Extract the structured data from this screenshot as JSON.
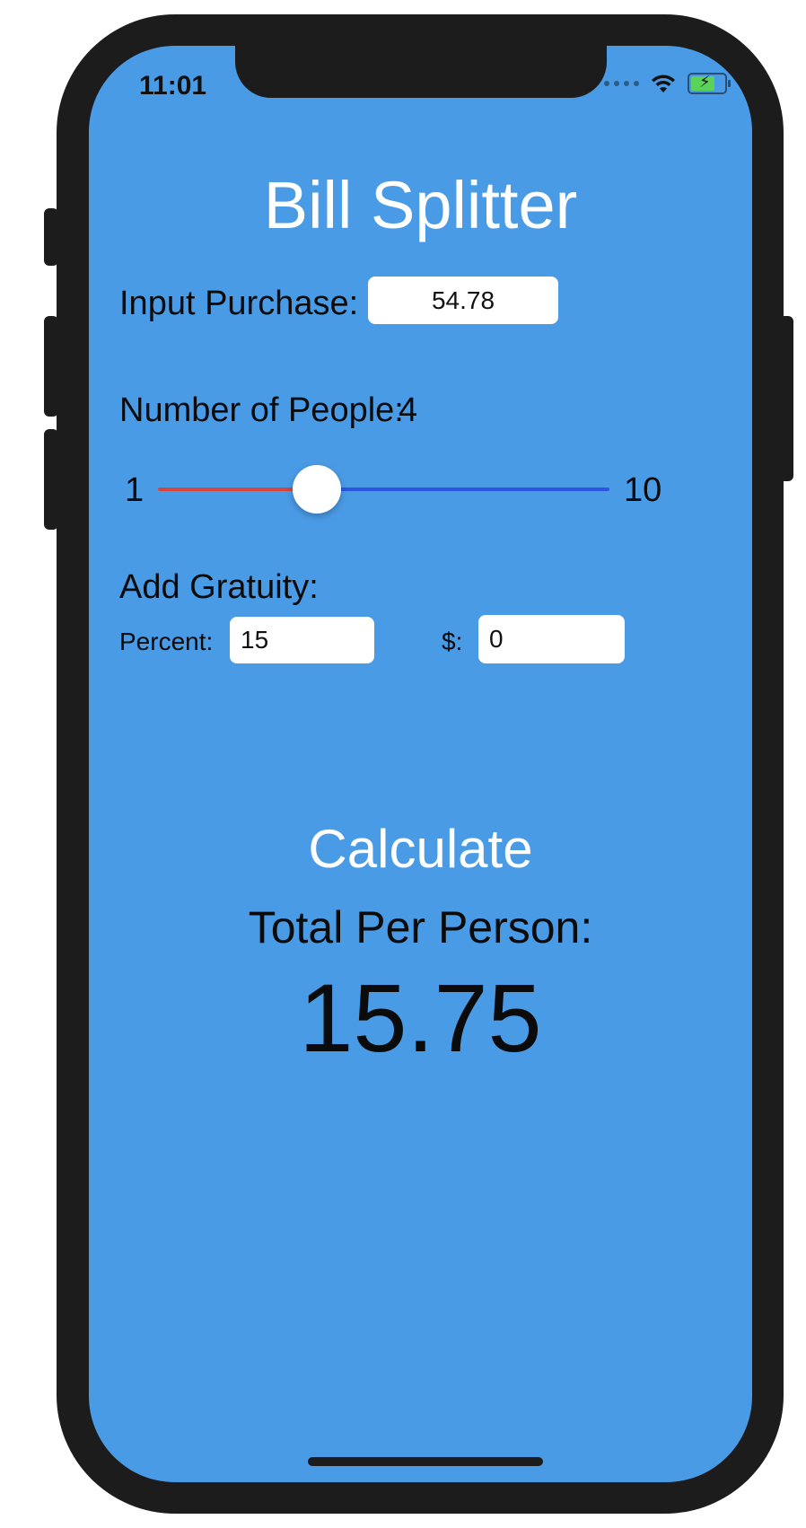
{
  "status_bar": {
    "time": "11:01",
    "battery_level": 0.8,
    "wifi_icon": "wifi-icon",
    "battery_icon": "battery-charging-icon"
  },
  "app": {
    "title": "Bill Splitter",
    "background_color": "#4a9be6"
  },
  "purchase": {
    "label": "Input Purchase:",
    "value": "54.78"
  },
  "people": {
    "label": "Number of People:",
    "value": "4",
    "slider_min_label": "1",
    "slider_max_label": "10",
    "slider_min": 1,
    "slider_max": 10,
    "slider_value": 4,
    "min_track_color": "#d7463c",
    "max_track_color": "#2c56e0"
  },
  "gratuity": {
    "label": "Add Gratuity:",
    "percent_label": "Percent:",
    "percent_value": "15",
    "dollar_label": "$:",
    "dollar_value": "0"
  },
  "calculate_button": {
    "label": "Calculate"
  },
  "result": {
    "label": "Total Per Person:",
    "value": "15.75"
  }
}
